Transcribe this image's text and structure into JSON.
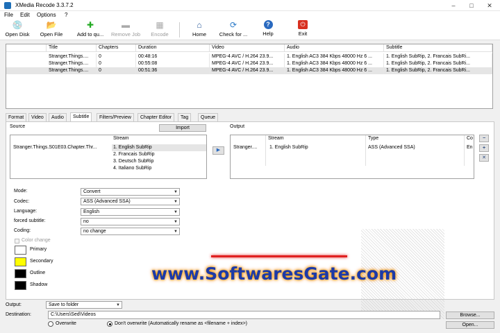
{
  "window": {
    "title": "XMedia Recode 3.3.7.2",
    "controls": [
      "–",
      "□",
      "✕"
    ]
  },
  "menu": [
    "File",
    "Edit",
    "Options",
    "?"
  ],
  "toolbar": [
    {
      "label": "Open Disk",
      "icon": "disc-icon",
      "glyph": "💿",
      "enabled": true
    },
    {
      "label": "Open File",
      "icon": "folder-icon",
      "glyph": "📂",
      "enabled": true
    },
    {
      "label": "Add to qu...",
      "icon": "plus-icon",
      "glyph": "✚",
      "enabled": true
    },
    {
      "label": "Remove Job",
      "icon": "minus-icon",
      "glyph": "▬",
      "enabled": false
    },
    {
      "label": "Encode",
      "icon": "film-icon",
      "glyph": "▦",
      "enabled": false
    },
    {
      "label": "Home",
      "icon": "home-icon",
      "glyph": "⌂",
      "enabled": true
    },
    {
      "label": "Check for ...",
      "icon": "refresh-icon",
      "glyph": "⟳",
      "enabled": true
    },
    {
      "label": "Help",
      "icon": "help-icon",
      "glyph": "?",
      "enabled": true
    },
    {
      "label": "Exit",
      "icon": "exit-icon",
      "glyph": "⏻",
      "enabled": true
    }
  ],
  "jobs": {
    "columns": [
      "Title",
      "Chapters",
      "Duration",
      "Video",
      "Audio",
      "Subtitle"
    ],
    "rows": [
      [
        "Stranger.Things....",
        "0",
        "00:48:16",
        "MPEG-4 AVC / H.264 23.9...",
        "1. English AC3 384 Kbps 48000 Hz 6 ...",
        "1. English SubRip, 2. Francais SubRi..."
      ],
      [
        "Stranger.Things....",
        "0",
        "00:55:08",
        "MPEG-4 AVC / H.264 23.9...",
        "1. English AC3 384 Kbps 48000 Hz 6 ...",
        "1. English SubRip, 2. Francais SubRi..."
      ],
      [
        "Stranger.Things....",
        "0",
        "00:51:36",
        "MPEG-4 AVC / H.264 23.9...",
        "1. English AC3 384 Kbps 48000 Hz 6 ...",
        "1. English SubRip, 2. Francais SubRi..."
      ]
    ]
  },
  "tabs": [
    "Format",
    "Video",
    "Audio",
    "Subtitle",
    "Filters/Preview",
    "Chapter Editor",
    "Tag",
    "Queue"
  ],
  "active_tab": "Subtitle",
  "source": {
    "label": "Source",
    "import_label": "Import",
    "file": "Stranger.Things.S01E03.Chapter.Thr...",
    "stream_header": "Stream",
    "streams": [
      "1. English SubRip",
      "2. Francais SubRip",
      "3. Deutsch SubRip",
      "4. Italiano SubRip"
    ]
  },
  "output_box": {
    "label": "Output",
    "columns": [
      "",
      "Stream",
      "Type",
      "Co"
    ],
    "row": [
      "Stranger....",
      "1. English SubRip",
      "ASS (Advanced SSA)",
      "En"
    ]
  },
  "side_buttons": [
    "−",
    "+",
    "✕"
  ],
  "form": [
    {
      "label": "Mode:",
      "value": "Convert"
    },
    {
      "label": "Codec:",
      "value": "ASS (Advanced SSA)"
    },
    {
      "label": "Language:",
      "value": "English"
    },
    {
      "label": "forced subtitle:",
      "value": "no"
    },
    {
      "label": "Coding:",
      "value": "no change"
    }
  ],
  "color_change": "Color change",
  "colors": [
    {
      "label": "Primary",
      "hex": "#ffffff"
    },
    {
      "label": "Secondary",
      "hex": "#ffff00"
    },
    {
      "label": "Outline",
      "hex": "#000000"
    },
    {
      "label": "Shadow",
      "hex": "#000000"
    }
  ],
  "watermark": "www.SoftwaresGate.com",
  "bottom": {
    "output_label": "Output:",
    "output_value": "Save to folder",
    "destination_label": "Destination:",
    "destination_value": "C:\\Users\\Sed\\Videos",
    "browse": "Browse...",
    "open": "Open...",
    "overwrite": "Overwrite",
    "dont_overwrite": "Don't overwrite (Automatically rename as <filename + index>)"
  }
}
